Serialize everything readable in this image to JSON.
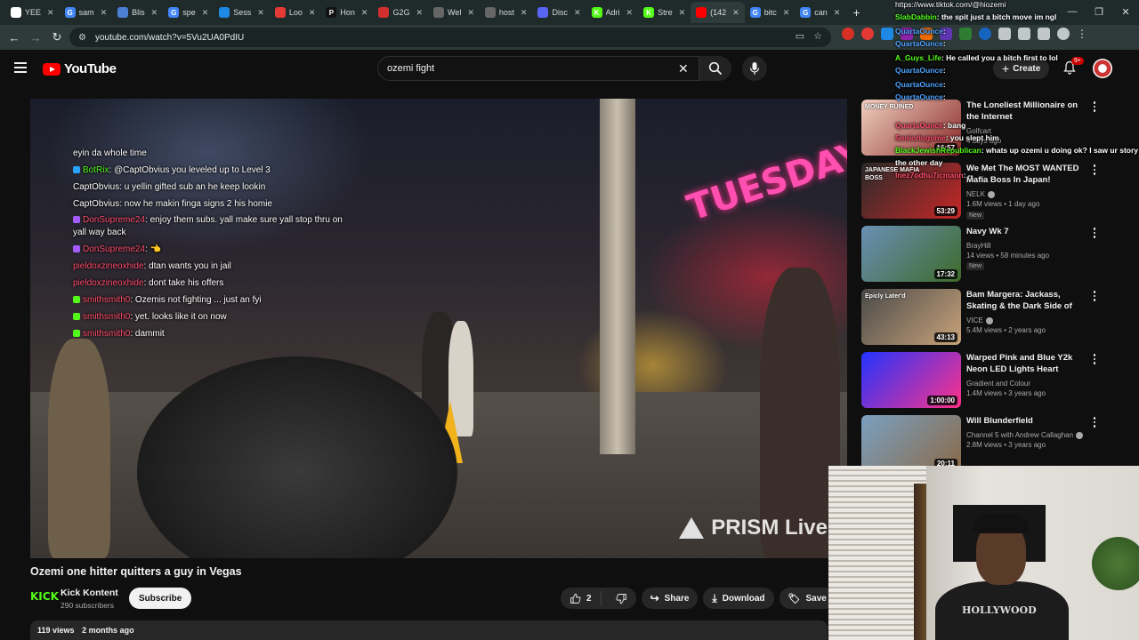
{
  "browser": {
    "tabs": [
      {
        "label": "YEE",
        "color": "#ffffff",
        "glyph": ""
      },
      {
        "label": "sam",
        "color": "#4285f4",
        "glyph": "G"
      },
      {
        "label": "Blis",
        "color": "#4a7fd4",
        "glyph": ""
      },
      {
        "label": "spe",
        "color": "#4285f4",
        "glyph": "G"
      },
      {
        "label": "Sess",
        "color": "#1e88e5",
        "glyph": ""
      },
      {
        "label": "Loo",
        "color": "#e53935",
        "glyph": ""
      },
      {
        "label": "Hon",
        "color": "#111111",
        "glyph": "P"
      },
      {
        "label": "G2G",
        "color": "#d32f2f",
        "glyph": ""
      },
      {
        "label": "Wel",
        "color": "#666666",
        "glyph": ""
      },
      {
        "label": "host",
        "color": "#666666",
        "glyph": ""
      },
      {
        "label": "Disc",
        "color": "#5865f2",
        "glyph": ""
      },
      {
        "label": "Adri",
        "color": "#53fc18",
        "glyph": "K"
      },
      {
        "label": "Stre",
        "color": "#53fc18",
        "glyph": "K"
      },
      {
        "label": "(142",
        "color": "#ff0000",
        "glyph": ""
      },
      {
        "label": "bitc",
        "color": "#4285f4",
        "glyph": "G"
      },
      {
        "label": "can",
        "color": "#4285f4",
        "glyph": "G"
      }
    ],
    "url": "youtube.com/watch?v=5Vu2UA0PdIU",
    "tab_overflow_url": "https://www.tiktok.com/@hiozemi"
  },
  "youtube": {
    "logo_text": "YouTube",
    "search_value": "ozemi fight",
    "create_label": "Create",
    "notif_badge": "9+"
  },
  "video": {
    "title": "Ozemi one hitter quitters a guy in Vegas",
    "watermark": "PRISM Live",
    "neon_sign": "TUESDAY",
    "chat": [
      {
        "user": "",
        "text": "eyin da whole time",
        "icon": "",
        "ucolor": "#ffffff"
      },
      {
        "user": "BotRix",
        "text": ": @CaptObvius you leveled up to Level 3",
        "icon": "#2aa3ff",
        "ucolor": "#53fc18"
      },
      {
        "user": "CaptObvius",
        "text": ": u yellin gifted sub an he keep lookin",
        "icon": "",
        "ucolor": "#ffffff"
      },
      {
        "user": "CaptObvius",
        "text": ": now he makin finga signs 2 his homie",
        "icon": "",
        "ucolor": "#ffffff"
      },
      {
        "user": "DonSupreme24",
        "text": ": enjoy them subs. yall make sure yall stop thru on yall way back",
        "icon": "#a45cff",
        "ucolor": "#ff4d6d"
      },
      {
        "user": "DonSupreme24",
        "text": ": 👈",
        "icon": "#a45cff",
        "ucolor": "#ff4d6d"
      },
      {
        "user": "pieldoxzineoxhide",
        "text": ": dtan wants you in jail",
        "icon": "",
        "ucolor": "#ff4d6d"
      },
      {
        "user": "pieldoxzineoxhide",
        "text": ": dont take his offers",
        "icon": "",
        "ucolor": "#ff4d6d"
      },
      {
        "user": "smithsmith0",
        "text": ": Ozemis not fighting ... just an fyi",
        "icon": "#53fc18",
        "ucolor": "#ff4d6d"
      },
      {
        "user": "smithsmith0",
        "text": ": yet. looks like it on now",
        "icon": "#53fc18",
        "ucolor": "#ff4d6d"
      },
      {
        "user": "smithsmith0",
        "text": ": dammit",
        "icon": "#53fc18",
        "ucolor": "#ff4d6d"
      }
    ]
  },
  "channel": {
    "logo_text": "KICK",
    "name": "Kick Kontent",
    "subs": "290 subscribers",
    "subscribe_label": "Subscribe"
  },
  "actions": {
    "likes": "2",
    "share": "Share",
    "download": "Download",
    "save": "Save"
  },
  "description": {
    "views": "119 views",
    "age": "2 months ago"
  },
  "recommendations": [
    {
      "title": "The Loneliest Millionaire on the Internet",
      "channel": "Golfcart",
      "views": "",
      "age": "4 days ago",
      "duration": "16:57",
      "new": "",
      "thumb": [
        "#f0d0c0",
        "#8b2a2a"
      ],
      "thumb_text": "MONEY RUINED"
    },
    {
      "title": "We Met The MOST WANTED Mafia Boss In Japan!",
      "channel": "NELK",
      "views": "1.6M views",
      "age": "1 day ago",
      "duration": "53:29",
      "new": "New",
      "thumb": [
        "#2a2a2a",
        "#c62828"
      ],
      "thumb_text": "JAPANESE MAFIA BOSS"
    },
    {
      "title": "Navy Wk 7",
      "channel": "BrayHill",
      "views": "14 views",
      "age": "58 minutes ago",
      "duration": "17:32",
      "new": "New",
      "thumb": [
        "#6a8fb5",
        "#3d6b2a"
      ],
      "thumb_text": ""
    },
    {
      "title": "Bam Margera: Jackass, Skating & the Dark Side of Fame | Epicl...",
      "channel": "VICE",
      "views": "5.4M views",
      "age": "2 years ago",
      "duration": "43:13",
      "new": "",
      "thumb": [
        "#4a4a4a",
        "#c9a37a"
      ],
      "thumb_text": "Epicly Later'd"
    },
    {
      "title": "Warped Pink and Blue Y2k Neon LED Lights Heart Background |...",
      "channel": "Gradient and Colour",
      "views": "1.4M views",
      "age": "3 years ago",
      "duration": "1:00:00",
      "new": "",
      "thumb": [
        "#2233ff",
        "#ff3388"
      ],
      "thumb_text": ""
    },
    {
      "title": "Will Blunderfield",
      "channel": "Channel 5 with Andrew Callaghan",
      "views": "2.8M views",
      "age": "3 years ago",
      "duration": "20:11",
      "new": "",
      "thumb": [
        "#7aa0c0",
        "#8a6a4a"
      ],
      "thumb_text": ""
    }
  ],
  "overlay_chat": [
    {
      "user": "SlabDabbin",
      "text": ": the spit just a bitch move im ngl",
      "ucolor": "#53fc18"
    },
    {
      "user": "QuartaOunce",
      "text": ": ",
      "ucolor": "#4fa3ff"
    },
    {
      "user": "QuartaOunce",
      "text": ": ",
      "ucolor": "#4fa3ff"
    },
    {
      "user": "A_Guys_Life",
      "text": ": He called you a bitch first to lol",
      "ucolor": "#53fc18"
    },
    {
      "user": "QuartaOunce",
      "text": ": ",
      "ucolor": "#4fa3ff"
    },
    {
      "user": "QuartaOunce",
      "text": ": ",
      "ucolor": "#4fa3ff"
    },
    {
      "user": "QuartaOunce",
      "text": ": ",
      "ucolor": "#4fa3ff"
    },
    {
      "user": "QuartaOunce",
      "text": ": bang",
      "ucolor": "#ff4d6d"
    },
    {
      "user": "Seniorlugome",
      "text": ": you slept him",
      "ucolor": "#ff4d6d"
    },
    {
      "user": "BlackJewishRepublican",
      "text": ": whats up ozemi u doing ok? I saw ur story",
      "ucolor": "#53fc18"
    },
    {
      "user": "",
      "text": "the other day",
      "ucolor": "#ffffff"
    },
    {
      "user": "Inez7odhu7icmann",
      "text": ": --",
      "ucolor": "#ff4d6d"
    }
  ],
  "webcam": {
    "shirt_text": "HOLLYWOOD"
  }
}
